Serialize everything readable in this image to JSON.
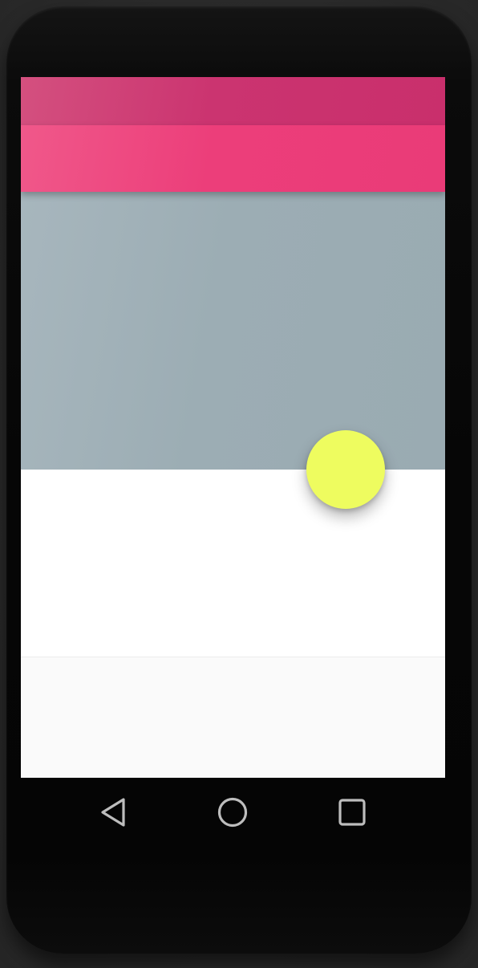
{
  "device": {
    "frame_color": "#0a0a0a",
    "background_color": "#2c2c2c"
  },
  "status_bar": {
    "color": "#cb3470"
  },
  "app_bar": {
    "color": "#ec3e7a"
  },
  "hero": {
    "color": "#9cadb4"
  },
  "content": {
    "card_color": "#ffffff",
    "lower_color": "#fafafa"
  },
  "fab": {
    "color": "#eefc5f",
    "icon": "none"
  },
  "navigation_bar": {
    "buttons": [
      {
        "icon": "back-triangle-icon"
      },
      {
        "icon": "home-circle-icon"
      },
      {
        "icon": "recents-square-icon"
      }
    ],
    "icon_color": "#bdbdbd"
  }
}
